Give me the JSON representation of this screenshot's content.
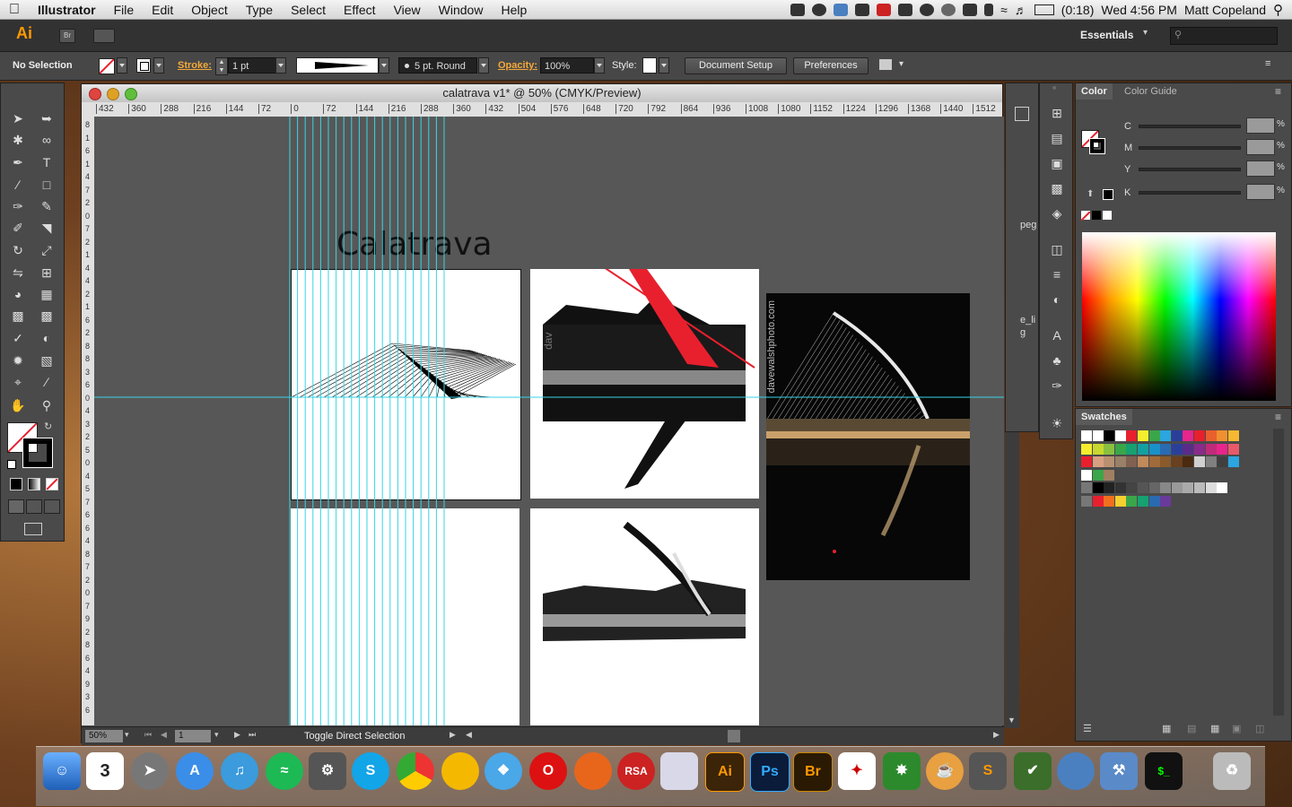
{
  "menubar": {
    "app": "Illustrator",
    "items": [
      "File",
      "Edit",
      "Object",
      "Type",
      "Select",
      "Effect",
      "View",
      "Window",
      "Help"
    ],
    "battery": "(0:18)",
    "clock": "Wed 4:56 PM",
    "user": "Matt Copeland"
  },
  "appbar": {
    "logo": "Ai",
    "bridge": "Br",
    "workspace": "Essentials"
  },
  "control": {
    "selection": "No Selection",
    "stroke_label": "Stroke:",
    "stroke_value": "1 pt",
    "brush": "5 pt. Round",
    "opacity_label": "Opacity:",
    "opacity_value": "100%",
    "style_label": "Style:",
    "document_setup": "Document Setup",
    "preferences": "Preferences"
  },
  "document": {
    "title": "calatrava v1* @ 50% (CMYK/Preview)",
    "heading": "Calatrava",
    "watermark": "davewalshphoto.com",
    "ruler_h": [
      "432",
      "360",
      "288",
      "216",
      "144",
      "72",
      "0",
      "72",
      "144",
      "216",
      "288",
      "360",
      "432",
      "504",
      "576",
      "648",
      "720",
      "792",
      "864",
      "936",
      "1008",
      "1080",
      "1152",
      "1224",
      "1296",
      "1368",
      "1440",
      "1512"
    ],
    "ruler_v": [
      "8",
      "1",
      "6",
      "1",
      "4",
      "7",
      "2",
      "0",
      "7",
      "2",
      "1",
      "4",
      "4",
      "2",
      "1",
      "6",
      "2",
      "8",
      "8",
      "3",
      "6",
      "0",
      "4",
      "3",
      "2",
      "5",
      "0",
      "4",
      "5",
      "7",
      "6",
      "6",
      "4",
      "8",
      "7",
      "2",
      "0",
      "7",
      "9",
      "2",
      "8",
      "6",
      "4",
      "9",
      "3",
      "6"
    ],
    "zoom": "50%",
    "page": "1",
    "status": "Toggle Direct Selection"
  },
  "color_panel": {
    "tab_color": "Color",
    "tab_guide": "Color Guide",
    "channels": [
      "C",
      "M",
      "Y",
      "K"
    ],
    "pct": "%"
  },
  "swatch_panel": {
    "title": "Swatches"
  },
  "side_labels": {
    "peg": "peg",
    "eli": "e_li",
    "g": "g"
  },
  "dock": {
    "ai": "Ai",
    "ps": "Ps",
    "br": "Br",
    "rsa": "RSA",
    "cal": "3"
  },
  "colors": {
    "guide": "#37d6e6",
    "accent": "#f3a93a",
    "red": "#e8202e"
  }
}
